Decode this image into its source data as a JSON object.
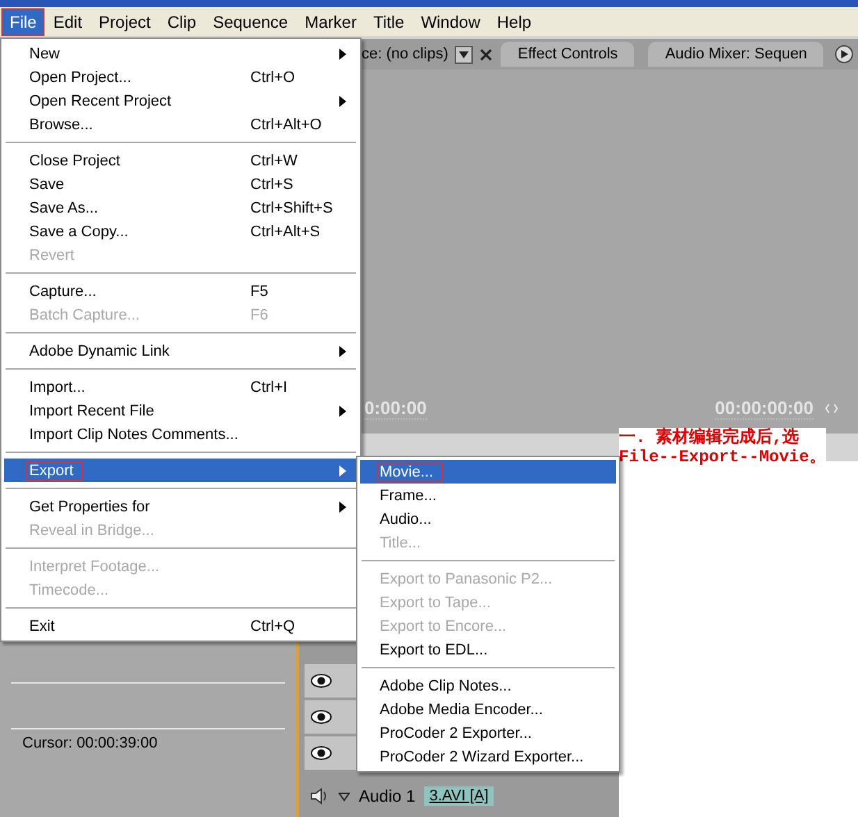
{
  "menubar": [
    {
      "label": "File",
      "selected": true,
      "marked": true
    },
    {
      "label": "Edit",
      "selected": false,
      "marked": false
    },
    {
      "label": "Project",
      "selected": false,
      "marked": false
    },
    {
      "label": "Clip",
      "selected": false,
      "marked": false
    },
    {
      "label": "Sequence",
      "selected": false,
      "marked": false
    },
    {
      "label": "Marker",
      "selected": false,
      "marked": false
    },
    {
      "label": "Title",
      "selected": false,
      "marked": false
    },
    {
      "label": "Window",
      "selected": false,
      "marked": false
    },
    {
      "label": "Help",
      "selected": false,
      "marked": false
    }
  ],
  "panel_tabs": [
    {
      "kind": "dropdown",
      "label": "ce: (no clips)"
    },
    {
      "kind": "tab",
      "label": "Effect Controls"
    },
    {
      "kind": "tab",
      "label": "Audio Mixer: Sequen"
    }
  ],
  "monitor": {
    "timecodes": [
      "0:00:00",
      "00:00:00:00"
    ]
  },
  "annotation": {
    "lines": [
      "一. 素材编辑完成后,选",
      "File--Export--Movie。"
    ]
  },
  "info_panel": {
    "cursor": "Cursor: 00:00:39:00"
  },
  "timeline": {
    "track_label": "Audio 1",
    "clip": "3.AVI [A]"
  },
  "file_menu": {
    "items": [
      {
        "kind": "item",
        "label": "New",
        "submenu": true,
        "disabled": false,
        "selected": false,
        "marked": false
      },
      {
        "kind": "item",
        "label": "Open Project...",
        "shortcut": "Ctrl+O",
        "submenu": false,
        "disabled": false,
        "selected": false,
        "marked": false
      },
      {
        "kind": "item",
        "label": "Open Recent Project",
        "submenu": true,
        "disabled": false,
        "selected": false,
        "marked": false
      },
      {
        "kind": "item",
        "label": "Browse...",
        "shortcut": "Ctrl+Alt+O",
        "submenu": false,
        "disabled": false,
        "selected": false,
        "marked": false
      },
      {
        "kind": "separator"
      },
      {
        "kind": "item",
        "label": "Close Project",
        "shortcut": "Ctrl+W",
        "submenu": false,
        "disabled": false,
        "selected": false,
        "marked": false
      },
      {
        "kind": "item",
        "label": "Save",
        "shortcut": "Ctrl+S",
        "submenu": false,
        "disabled": false,
        "selected": false,
        "marked": false
      },
      {
        "kind": "item",
        "label": "Save As...",
        "shortcut": "Ctrl+Shift+S",
        "submenu": false,
        "disabled": false,
        "selected": false,
        "marked": false
      },
      {
        "kind": "item",
        "label": "Save a Copy...",
        "shortcut": "Ctrl+Alt+S",
        "submenu": false,
        "disabled": false,
        "selected": false,
        "marked": false
      },
      {
        "kind": "item",
        "label": "Revert",
        "submenu": false,
        "disabled": true,
        "selected": false,
        "marked": false
      },
      {
        "kind": "separator"
      },
      {
        "kind": "item",
        "label": "Capture...",
        "shortcut": "F5",
        "submenu": false,
        "disabled": false,
        "selected": false,
        "marked": false
      },
      {
        "kind": "item",
        "label": "Batch Capture...",
        "shortcut": "F6",
        "submenu": false,
        "disabled": true,
        "selected": false,
        "marked": false
      },
      {
        "kind": "separator"
      },
      {
        "kind": "item",
        "label": "Adobe Dynamic Link",
        "submenu": true,
        "disabled": false,
        "selected": false,
        "marked": false
      },
      {
        "kind": "separator"
      },
      {
        "kind": "item",
        "label": "Import...",
        "shortcut": "Ctrl+I",
        "submenu": false,
        "disabled": false,
        "selected": false,
        "marked": false
      },
      {
        "kind": "item",
        "label": "Import Recent File",
        "submenu": true,
        "disabled": false,
        "selected": false,
        "marked": false
      },
      {
        "kind": "item",
        "label": "Import Clip Notes Comments...",
        "submenu": false,
        "disabled": false,
        "selected": false,
        "marked": false
      },
      {
        "kind": "separator"
      },
      {
        "kind": "item",
        "label": "Export",
        "submenu": true,
        "disabled": false,
        "selected": true,
        "marked": true
      },
      {
        "kind": "separator"
      },
      {
        "kind": "item",
        "label": "Get Properties for",
        "submenu": true,
        "disabled": false,
        "selected": false,
        "marked": false
      },
      {
        "kind": "item",
        "label": "Reveal in Bridge...",
        "submenu": false,
        "disabled": true,
        "selected": false,
        "marked": false
      },
      {
        "kind": "separator"
      },
      {
        "kind": "item",
        "label": "Interpret Footage...",
        "submenu": false,
        "disabled": true,
        "selected": false,
        "marked": false
      },
      {
        "kind": "item",
        "label": "Timecode...",
        "submenu": false,
        "disabled": true,
        "selected": false,
        "marked": false
      },
      {
        "kind": "separator"
      },
      {
        "kind": "item",
        "label": "Exit",
        "shortcut": "Ctrl+Q",
        "submenu": false,
        "disabled": false,
        "selected": false,
        "marked": false
      }
    ]
  },
  "export_menu": {
    "items": [
      {
        "kind": "item",
        "label": "Movie...",
        "submenu": false,
        "disabled": false,
        "selected": true,
        "marked": true
      },
      {
        "kind": "item",
        "label": "Frame...",
        "submenu": false,
        "disabled": false,
        "selected": false,
        "marked": false
      },
      {
        "kind": "item",
        "label": "Audio...",
        "submenu": false,
        "disabled": false,
        "selected": false,
        "marked": false
      },
      {
        "kind": "item",
        "label": "Title...",
        "submenu": false,
        "disabled": true,
        "selected": false,
        "marked": false
      },
      {
        "kind": "separator"
      },
      {
        "kind": "item",
        "label": "Export to Panasonic P2...",
        "submenu": false,
        "disabled": true,
        "selected": false,
        "marked": false
      },
      {
        "kind": "item",
        "label": "Export to Tape...",
        "submenu": false,
        "disabled": true,
        "selected": false,
        "marked": false
      },
      {
        "kind": "item",
        "label": "Export to Encore...",
        "submenu": false,
        "disabled": true,
        "selected": false,
        "marked": false
      },
      {
        "kind": "item",
        "label": "Export to EDL...",
        "submenu": false,
        "disabled": false,
        "selected": false,
        "marked": false
      },
      {
        "kind": "separator"
      },
      {
        "kind": "item",
        "label": "Adobe Clip Notes...",
        "submenu": false,
        "disabled": false,
        "selected": false,
        "marked": false
      },
      {
        "kind": "item",
        "label": "Adobe Media Encoder...",
        "submenu": false,
        "disabled": false,
        "selected": false,
        "marked": false
      },
      {
        "kind": "item",
        "label": "ProCoder 2 Exporter...",
        "submenu": false,
        "disabled": false,
        "selected": false,
        "marked": false
      },
      {
        "kind": "item",
        "label": "ProCoder 2 Wizard Exporter...",
        "submenu": false,
        "disabled": false,
        "selected": false,
        "marked": false
      }
    ]
  }
}
